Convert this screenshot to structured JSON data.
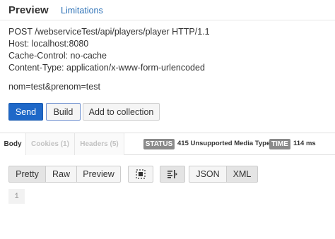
{
  "tabs": {
    "preview": "Preview",
    "limitations": "Limitations"
  },
  "request": {
    "lines": [
      "POST /webserviceTest/api/players/player HTTP/1.1",
      "Host: localhost:8080",
      "Cache-Control: no-cache",
      "Content-Type: application/x-www-form-urlencoded"
    ],
    "body": "nom=test&prenom=test"
  },
  "buttons": {
    "send": "Send",
    "build": "Build",
    "add_to_collection": "Add to collection"
  },
  "response": {
    "tabs": {
      "body": "Body",
      "cookies": "Cookies (1)",
      "headers": "Headers (5)"
    },
    "status_label": "STATUS",
    "status_value": "415 Unsupported Media Type",
    "time_label": "TIME",
    "time_value": "114 ms"
  },
  "toolbar": {
    "pretty": "Pretty",
    "raw": "Raw",
    "preview": "Preview",
    "wrap_icon": "wrap-icon",
    "align_icon": "align-icon",
    "json": "JSON",
    "xml": "XML"
  },
  "editor": {
    "line_number": "1"
  }
}
